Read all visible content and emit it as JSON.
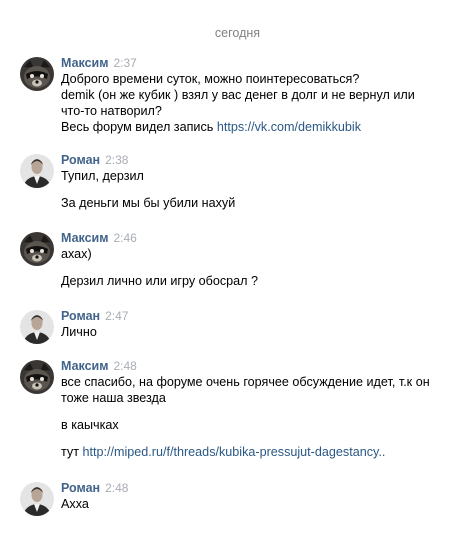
{
  "date_separator": "сегодня",
  "authors": {
    "maksim": {
      "name": "Максим",
      "avatar_icon": "raccoon-avatar-icon"
    },
    "roman": {
      "name": "Роман",
      "avatar_icon": "man-portrait-avatar-icon"
    }
  },
  "colors": {
    "author": "#42648b",
    "link": "#2a5885",
    "time": "#a8adb4",
    "date": "#828282"
  },
  "messages": [
    {
      "author": "Максим",
      "time": "2:37",
      "lines": [
        "Доброго времени суток, можно поинтересоваться?",
        "demik (он же кубик ) взял у вас денег в долг и не вернул или",
        "что-то натворил?"
      ],
      "link_line": {
        "prefix": "Весь форум видел запись ",
        "link": "https://vk.com/demikkubik"
      }
    },
    {
      "author": "Роман",
      "time": "2:38",
      "lines": [
        "Тупил, дерзил"
      ],
      "lines2": [
        "За деньги мы бы убили нахуй"
      ]
    },
    {
      "author": "Максим",
      "time": "2:46",
      "lines": [
        "ахах)"
      ],
      "lines2": [
        "Дерзил лично или игру обосрал ?"
      ]
    },
    {
      "author": "Роман",
      "time": "2:47",
      "lines": [
        "Лично"
      ]
    },
    {
      "author": "Максим",
      "time": "2:48",
      "lines": [
        "все спасибо, на форуме очень горячее обсуждение идет, т.к он",
        "тоже наша звезда"
      ],
      "lines2": [
        "в каычках"
      ],
      "link_line": {
        "prefix": "тут ",
        "link": "http://miped.ru/f/threads/kubika-pressujut-dagestancy.."
      }
    },
    {
      "author": "Роман",
      "time": "2:48",
      "lines": [
        "Ахха"
      ]
    }
  ]
}
